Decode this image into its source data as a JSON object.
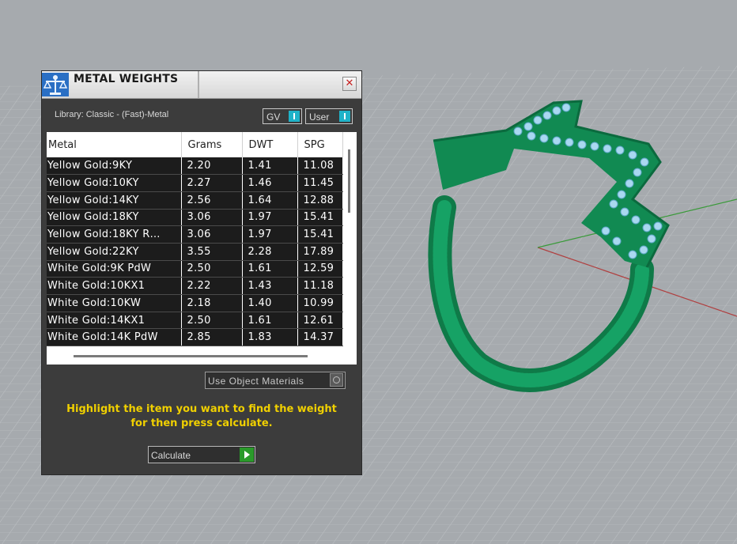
{
  "window": {
    "title": "METAL WEIGHTS",
    "icon": "scale-icon",
    "close_icon": "close-icon"
  },
  "library": {
    "label": "Library: Classic - (Fast)-Metal"
  },
  "toggles": {
    "gv": "GV",
    "user": "User"
  },
  "table": {
    "columns": [
      "Metal",
      "Grams",
      "DWT",
      "SPG"
    ],
    "rows": [
      {
        "metal": "Yellow Gold:9KY",
        "grams": "2.20",
        "dwt": "1.41",
        "spg": "11.08"
      },
      {
        "metal": "Yellow Gold:10KY",
        "grams": "2.27",
        "dwt": "1.46",
        "spg": "11.45"
      },
      {
        "metal": "Yellow Gold:14KY",
        "grams": "2.56",
        "dwt": "1.64",
        "spg": "12.88"
      },
      {
        "metal": "Yellow Gold:18KY",
        "grams": "3.06",
        "dwt": "1.97",
        "spg": "15.41"
      },
      {
        "metal": "Yellow Gold:18KY R…",
        "grams": "3.06",
        "dwt": "1.97",
        "spg": "15.41"
      },
      {
        "metal": "Yellow Gold:22KY",
        "grams": "3.55",
        "dwt": "2.28",
        "spg": "17.89"
      },
      {
        "metal": "White Gold:9K PdW",
        "grams": "2.50",
        "dwt": "1.61",
        "spg": "12.59"
      },
      {
        "metal": "White Gold:10KX1",
        "grams": "2.22",
        "dwt": "1.43",
        "spg": "11.18"
      },
      {
        "metal": "White Gold:10KW",
        "grams": "2.18",
        "dwt": "1.40",
        "spg": "10.99"
      },
      {
        "metal": "White Gold:14KX1",
        "grams": "2.50",
        "dwt": "1.61",
        "spg": "12.61"
      },
      {
        "metal": "White Gold:14K PdW",
        "grams": "2.85",
        "dwt": "1.83",
        "spg": "14.37"
      }
    ]
  },
  "use_materials": {
    "label": "Use Object Materials"
  },
  "instructions": {
    "line1": "Highlight the item you want to find the weight",
    "line2": "for then press calculate."
  },
  "calculate": {
    "label": "Calculate",
    "icon": "play-icon"
  },
  "colors": {
    "viewport_bg": "#a6aaae",
    "ring_green": "#138a55",
    "stone_blue": "#a9d8f0",
    "instruction_yellow": "#f0d000",
    "toggle_accent": "#1fb2c8"
  }
}
